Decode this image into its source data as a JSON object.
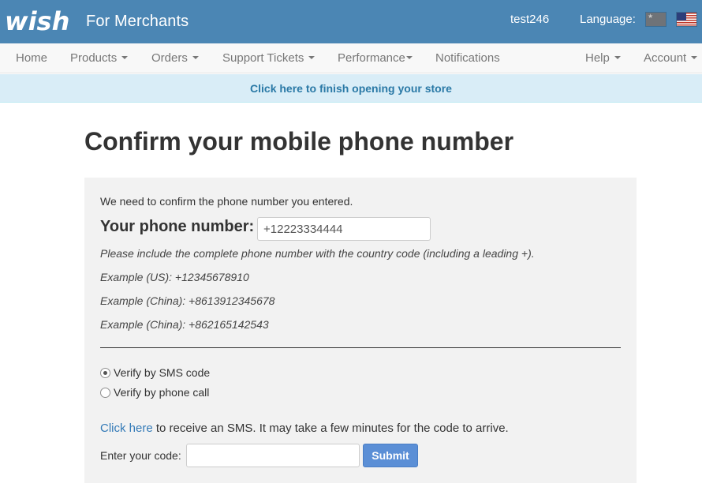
{
  "header": {
    "logo_text": "wish",
    "brand_subtitle": "For Merchants",
    "username": "test246",
    "language_label": "Language:",
    "flags": [
      {
        "icon": "china-flag-icon"
      },
      {
        "icon": "us-flag-icon"
      }
    ],
    "colors": {
      "header_bg": "#4b86b4"
    }
  },
  "nav": {
    "home": "Home",
    "products": "Products",
    "orders": "Orders",
    "support_tickets": "Support Tickets",
    "performance": "Performance",
    "notifications": "Notifications",
    "help": "Help",
    "account": "Account"
  },
  "banner": {
    "link_text": "Click here to finish opening your store"
  },
  "page": {
    "title": "Confirm your mobile phone number"
  },
  "form": {
    "intro": "We need to confirm the phone number you entered.",
    "phone_label": "Your phone number:",
    "phone_value": "+12223334444",
    "help_text": "Please include the complete phone number with the country code (including a leading +).",
    "examples": [
      "Example (US): +12345678910",
      "Example (China): +8613912345678",
      "Example (China): +862165142543"
    ],
    "verify_options": [
      {
        "label": "Verify by SMS code",
        "checked": true
      },
      {
        "label": "Verify by phone call",
        "checked": false
      }
    ],
    "sms_link": "Click here",
    "sms_text": " to receive an SMS. It may take a few minutes for the code to arrive.",
    "code_label": "Enter your code:",
    "code_value": "",
    "submit_label": "Submit"
  }
}
